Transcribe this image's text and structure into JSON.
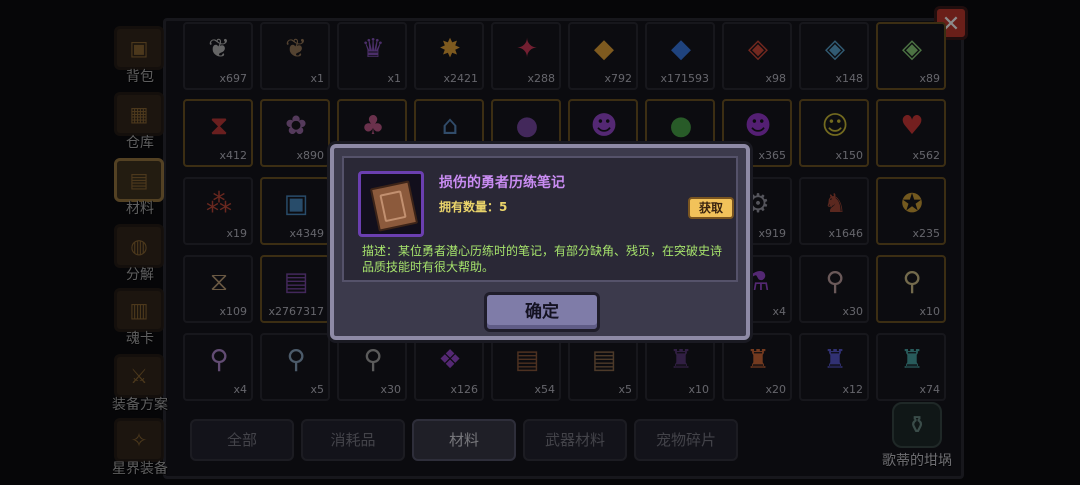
{
  "close_label": "✕",
  "sidebar": {
    "items": [
      {
        "label": "背包",
        "icon": "chest-icon"
      },
      {
        "label": "仓库",
        "icon": "warehouse-icon"
      },
      {
        "label": "材料",
        "icon": "material-icon",
        "active": true
      },
      {
        "label": "分解",
        "icon": "decompose-icon"
      },
      {
        "label": "魂卡",
        "icon": "soul-card-icon"
      },
      {
        "label": "装备方案",
        "icon": "equipment-plan-icon"
      },
      {
        "label": "星界装备",
        "icon": "astral-equipment-icon"
      }
    ]
  },
  "grid": {
    "rows": [
      [
        {
          "icon": "horn-icon",
          "glyph": "❦",
          "color": "#b9b9b9",
          "count": "x697"
        },
        {
          "icon": "horn-icon",
          "glyph": "❦",
          "color": "#9a7a5a",
          "count": "x1"
        },
        {
          "icon": "purple-crest-icon",
          "glyph": "♛",
          "color": "#8a56c2",
          "count": "x1"
        },
        {
          "icon": "gold-spark-icon",
          "glyph": "✸",
          "color": "#e6a43a",
          "count": "x2421"
        },
        {
          "icon": "red-crystal-icon",
          "glyph": "✦",
          "color": "#d23a5a",
          "count": "x288"
        },
        {
          "icon": "gold-crystal-icon",
          "glyph": "◆",
          "color": "#e6a43a",
          "count": "x792"
        },
        {
          "icon": "blue-crystal-icon",
          "glyph": "◆",
          "color": "#3a7ae6",
          "count": "x171593"
        },
        {
          "icon": "red-gem-icon",
          "glyph": "◈",
          "color": "#d24a3a",
          "count": "x98"
        },
        {
          "icon": "blue-gem-icon",
          "glyph": "◈",
          "color": "#5aa6d2",
          "count": "x148"
        },
        {
          "icon": "rainbow-gem-icon",
          "glyph": "◈",
          "color": "#8ad27a",
          "count": "x89"
        }
      ],
      [
        {
          "icon": "rune-icon",
          "glyph": "⧗",
          "color": "#c23a3a",
          "count": "x412"
        },
        {
          "icon": "shell-icon",
          "glyph": "✿",
          "color": "#9a6aa6",
          "count": "x890"
        },
        {
          "icon": "demon-icon",
          "glyph": "♣",
          "color": "#c25a8a",
          "count": ""
        },
        {
          "icon": "house-icon",
          "glyph": "⌂",
          "color": "#5a8ac2",
          "count": ""
        },
        {
          "icon": "purple-orb-icon",
          "glyph": "●",
          "color": "#7a4aa6",
          "count": ""
        },
        {
          "icon": "mask-icon",
          "glyph": "☻",
          "color": "#9a4ad2",
          "count": ""
        },
        {
          "icon": "green-slime-icon",
          "glyph": "●",
          "color": "#4aa64a",
          "count": ""
        },
        {
          "icon": "purple-mask-icon",
          "glyph": "☻",
          "color": "#9a3ad2",
          "count": "x365"
        },
        {
          "icon": "smiley-icon",
          "glyph": "☺",
          "color": "#d2c23a",
          "count": "x150"
        },
        {
          "icon": "heart-icon",
          "glyph": "♥",
          "color": "#d23a3a",
          "count": "x562"
        }
      ],
      [
        {
          "icon": "berries-icon",
          "glyph": "⁂",
          "color": "#c24a3a",
          "count": "x19"
        },
        {
          "icon": "cubes-icon",
          "glyph": "▣",
          "color": "#4a8ac2",
          "count": "x4349"
        },
        {
          "icon": "blank-icon",
          "glyph": "",
          "color": "#777",
          "count": ""
        },
        {
          "icon": "blank-icon",
          "glyph": "",
          "color": "#777",
          "count": ""
        },
        {
          "icon": "blank-icon",
          "glyph": "",
          "color": "#777",
          "count": ""
        },
        {
          "icon": "blank-icon",
          "glyph": "",
          "color": "#777",
          "count": ""
        },
        {
          "icon": "blank-icon",
          "glyph": "",
          "color": "#777",
          "count": ""
        },
        {
          "icon": "gear-icon",
          "glyph": "⚙",
          "color": "#9a9aa6",
          "count": "x919"
        },
        {
          "icon": "boar-icon",
          "glyph": "♞",
          "color": "#a64a3a",
          "count": "x1646"
        },
        {
          "icon": "medal-icon",
          "glyph": "✪",
          "color": "#d2a23a",
          "count": "x235"
        }
      ],
      [
        {
          "icon": "hourglass-icon",
          "glyph": "⧖",
          "color": "#c2a27a",
          "count": "x109"
        },
        {
          "icon": "exp-book-icon",
          "glyph": "▤",
          "color": "#7a4aa6",
          "count": "x2767317"
        },
        {
          "icon": "blank-icon",
          "glyph": "",
          "color": "#777",
          "count": ""
        },
        {
          "icon": "blank-icon",
          "glyph": "",
          "color": "#777",
          "count": ""
        },
        {
          "icon": "blank-icon",
          "glyph": "",
          "color": "#777",
          "count": ""
        },
        {
          "icon": "blank-icon",
          "glyph": "",
          "color": "#777",
          "count": ""
        },
        {
          "icon": "blank-icon",
          "glyph": "",
          "color": "#777",
          "count": ""
        },
        {
          "icon": "purple-potion-icon",
          "glyph": "⚗",
          "color": "#9a4ad2",
          "count": "x4"
        },
        {
          "icon": "magnifier-icon",
          "glyph": "⚲",
          "color": "#c2a2a2",
          "count": "x30"
        },
        {
          "icon": "magnifier-icon",
          "glyph": "⚲",
          "color": "#d2c28a",
          "count": "x10"
        }
      ],
      [
        {
          "icon": "magnifier-icon",
          "glyph": "⚲",
          "color": "#b28ad2",
          "count": "x4"
        },
        {
          "icon": "magnifier-icon",
          "glyph": "⚲",
          "color": "#8aa6c2",
          "count": "x5"
        },
        {
          "icon": "magnifier-icon",
          "glyph": "⚲",
          "color": "#a6a6a6",
          "count": "x30"
        },
        {
          "icon": "purple-scroll-icon",
          "glyph": "❖",
          "color": "#9a4ad2",
          "count": "x126"
        },
        {
          "icon": "book-icon",
          "glyph": "▤",
          "color": "#8c5a3c",
          "count": "x54"
        },
        {
          "icon": "book-icon",
          "glyph": "▤",
          "color": "#8c6a4c",
          "count": "x5"
        },
        {
          "icon": "dark-crest-icon",
          "glyph": "♜",
          "color": "#5a3a7a",
          "count": "x10"
        },
        {
          "icon": "fire-crest-icon",
          "glyph": "♜",
          "color": "#d26a3a",
          "count": "x20"
        },
        {
          "icon": "blue-crest-icon",
          "glyph": "♜",
          "color": "#5a5ad2",
          "count": "x12"
        },
        {
          "icon": "teal-crest-icon",
          "glyph": "♜",
          "color": "#4aa6a6",
          "count": "x74"
        }
      ]
    ]
  },
  "tabs": [
    {
      "label": "全部"
    },
    {
      "label": "消耗品"
    },
    {
      "label": "材料",
      "active": true
    },
    {
      "label": "武器材料"
    },
    {
      "label": "宠物碎片"
    }
  ],
  "special": {
    "label": "歌蒂的坩埚",
    "icon": "cauldron-icon"
  },
  "dialog": {
    "item_name": "损伤的勇者历练笔记",
    "owned_label": "拥有数量：",
    "owned_count": "5",
    "get_label": "获取",
    "description": "描述：某位勇者潜心历练时的笔记，有部分缺角、残页，在突破史诗品质技能时有很大帮助。",
    "confirm_label": "确定"
  }
}
